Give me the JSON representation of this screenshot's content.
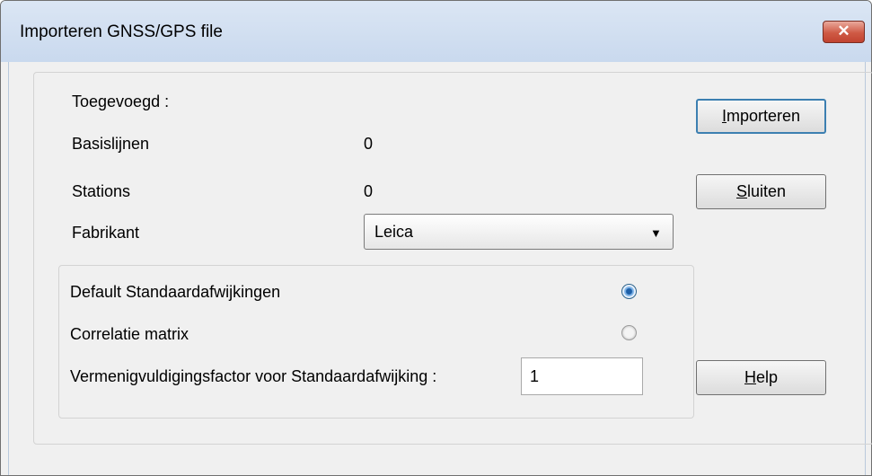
{
  "window": {
    "title": "Importeren GNSS/GPS file",
    "close_label": "✕"
  },
  "summary": {
    "added_label": "Toegevoegd :",
    "baselines_label": "Basislijnen",
    "baselines_value": "0",
    "stations_label": "Stations",
    "stations_value": "0",
    "manufacturer_label": "Fabrikant",
    "manufacturer_value": "Leica"
  },
  "options": {
    "default_std_label": "Default Standaardafwijkingen",
    "default_std_selected": true,
    "correlation_label": "Correlatie matrix",
    "correlation_selected": false,
    "factor_label": "Vermenigvuldigingsfactor voor Standaardafwijking :",
    "factor_value": "1"
  },
  "buttons": {
    "import": {
      "mnemonic": "I",
      "rest": "mporteren"
    },
    "close": {
      "mnemonic": "S",
      "rest": "luiten"
    },
    "help": {
      "mnemonic": "H",
      "rest": "elp"
    }
  },
  "icons": {
    "close": "close-icon",
    "dropdown": "chevron-down-icon"
  },
  "colors": {
    "titlebar": "#c9d9ee",
    "close_button": "#c14330",
    "default_button_border": "#3c7fb1"
  }
}
